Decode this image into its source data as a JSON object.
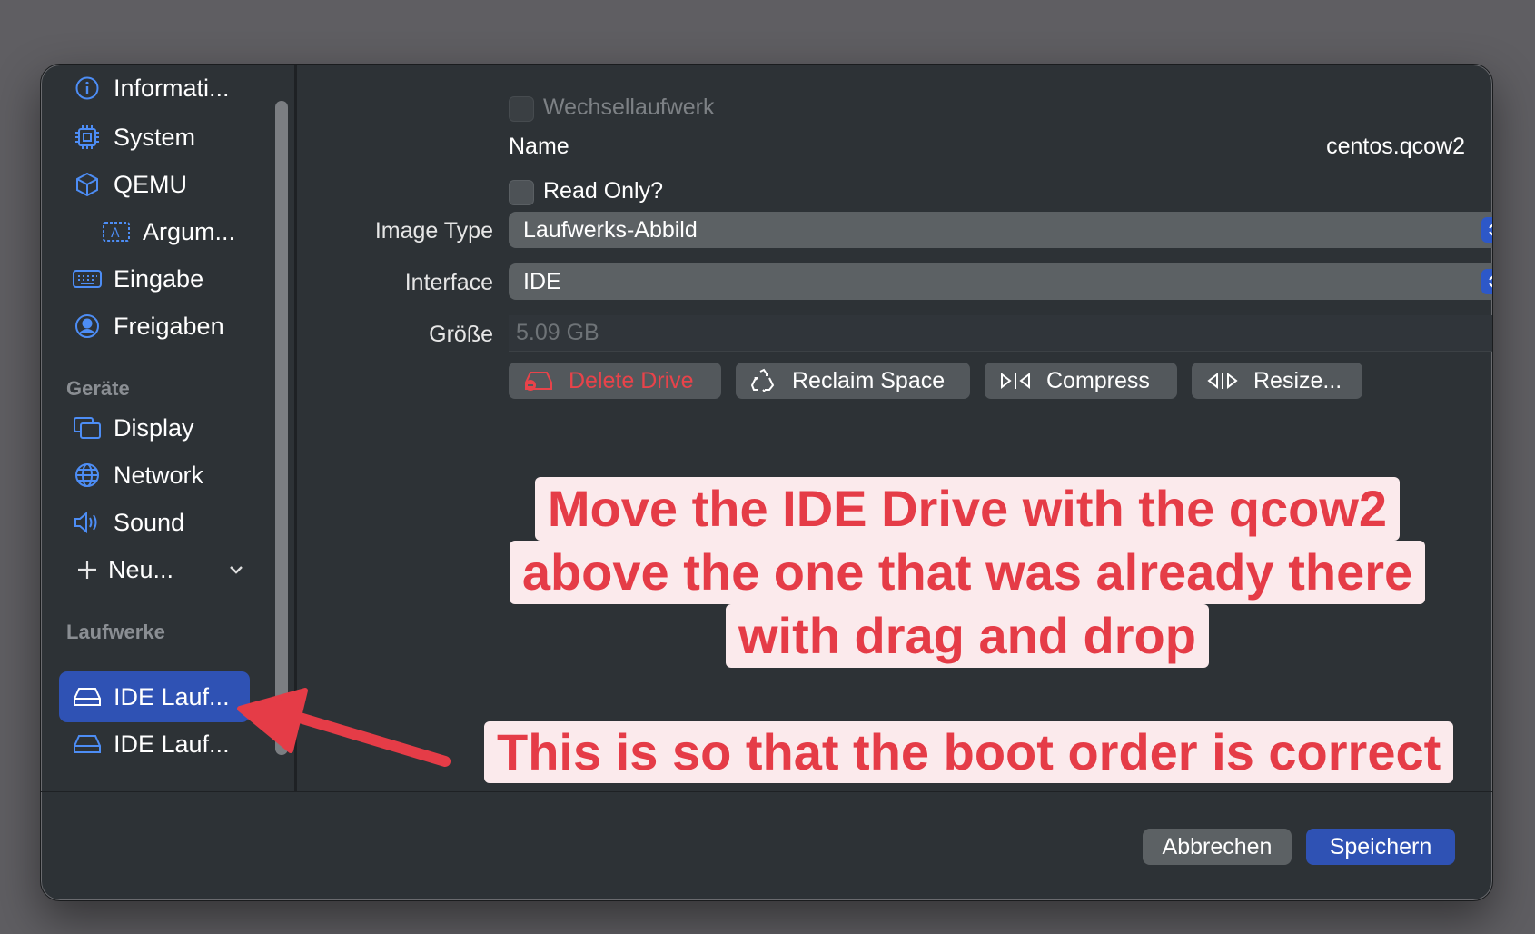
{
  "sidebar": {
    "items": [
      {
        "label": "Informati...",
        "icon": "info-icon"
      },
      {
        "label": "System",
        "icon": "cpu-icon"
      },
      {
        "label": "QEMU",
        "icon": "cube-icon"
      },
      {
        "label": "Argum...",
        "icon": "argument-icon"
      },
      {
        "label": "Eingabe",
        "icon": "keyboard-icon"
      },
      {
        "label": "Freigaben",
        "icon": "person-circle-icon"
      }
    ],
    "devices_header": "Geräte",
    "devices": [
      {
        "label": "Display",
        "icon": "display-icon"
      },
      {
        "label": "Network",
        "icon": "globe-icon"
      },
      {
        "label": "Sound",
        "icon": "speaker-icon"
      },
      {
        "label": "Neu...",
        "icon": "plus-icon"
      }
    ],
    "drives_header": "Laufwerke",
    "drives": [
      {
        "label": "IDE Lauf...",
        "icon": "drive-icon",
        "selected": true
      },
      {
        "label": "IDE Lauf...",
        "icon": "drive-icon",
        "selected": false
      }
    ]
  },
  "form": {
    "removable_label": "Wechsellaufwerk",
    "name_label": "Name",
    "name_value": "centos.qcow2",
    "readonly_label": "Read Only?",
    "image_type_label": "Image Type",
    "image_type_value": "Laufwerks-Abbild",
    "interface_label": "Interface",
    "interface_value": "IDE",
    "size_label": "Größe",
    "size_value": "5.09 GB"
  },
  "actions": {
    "delete": "Delete Drive",
    "reclaim": "Reclaim Space",
    "compress": "Compress",
    "resize": "Resize..."
  },
  "footer": {
    "cancel": "Abbrechen",
    "save": "Speichern"
  },
  "annotations": {
    "line1": "Move the IDE Drive with the qcow2",
    "line2": "above the one that was already there",
    "line3": "with drag and drop",
    "note": "This is so that the boot order is correct"
  },
  "colors": {
    "accent": "#2f52b4",
    "annotation_text": "#e53c47",
    "annotation_bg": "#fbeaec",
    "danger": "#e8434a"
  }
}
